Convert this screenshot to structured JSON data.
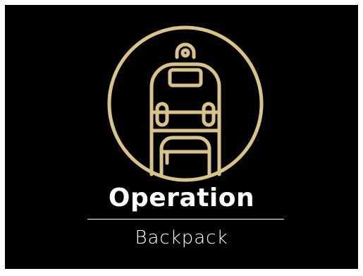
{
  "logo": {
    "icon": "backpack-icon",
    "color": "#d8c48a"
  },
  "title": "Operation",
  "subtitle": "Backpack",
  "colors": {
    "background": "#000000",
    "text": "#ffffff",
    "accent": "#d8c48a"
  }
}
